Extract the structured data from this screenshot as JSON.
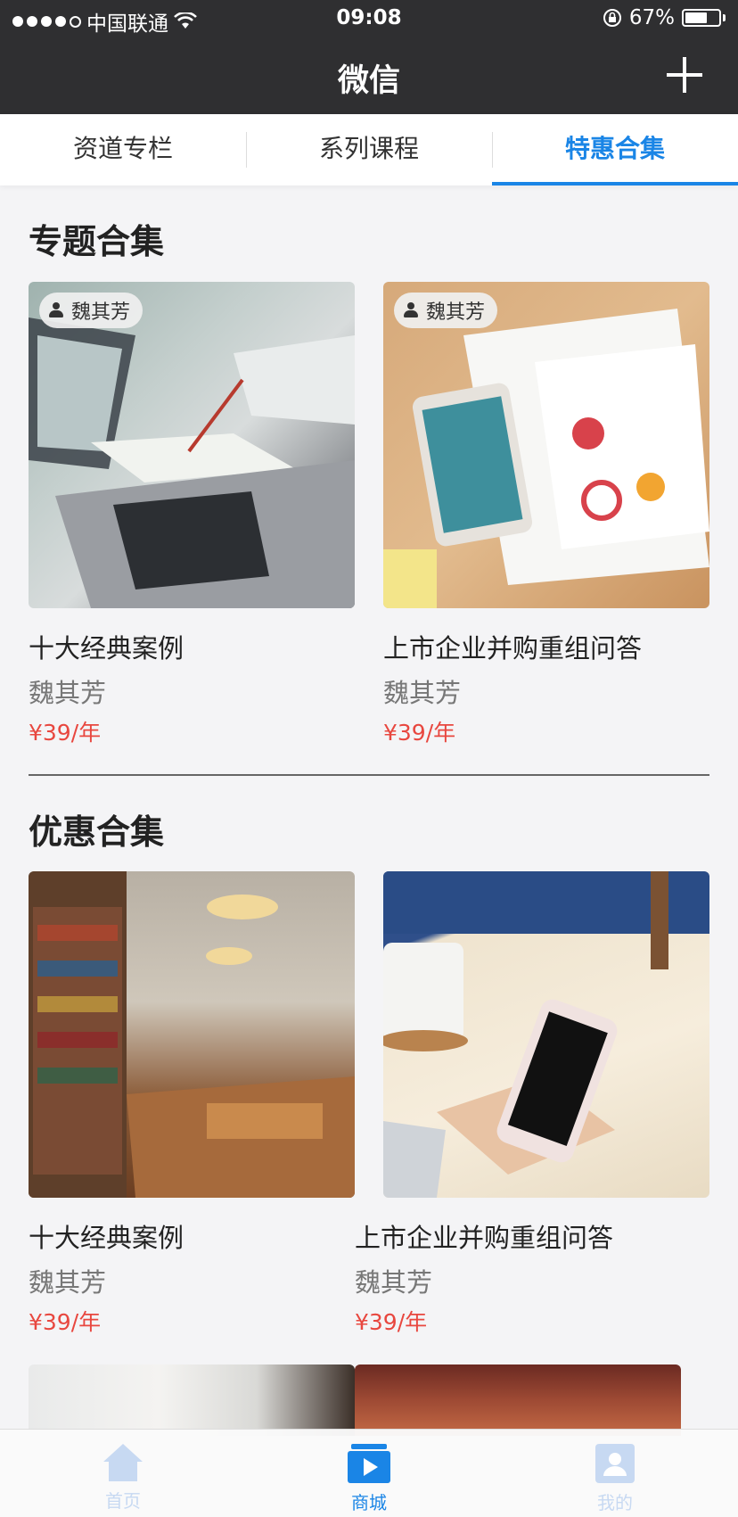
{
  "status": {
    "carrier": "中国联通",
    "time": "09:08",
    "battery_text": "67%",
    "battery_level": 0.67
  },
  "nav": {
    "title": "微信"
  },
  "tabs": [
    {
      "label": "资道专栏",
      "active": false
    },
    {
      "label": "系列课程",
      "active": false
    },
    {
      "label": "特惠合集",
      "active": true
    }
  ],
  "sections": {
    "topics": {
      "title": "专题合集",
      "cards": [
        {
          "tag": "魏其芳",
          "title": "十大经典案例",
          "author": "魏其芳",
          "price": "¥39/年"
        },
        {
          "tag": "魏其芳",
          "title": "上市企业并购重组问答",
          "author": "魏其芳",
          "price": "¥39/年"
        }
      ]
    },
    "deals": {
      "title": "优惠合集",
      "cards": [
        {
          "title": "十大经典案例",
          "author": "魏其芳",
          "price": "¥39/年"
        },
        {
          "title": "上市企业并购重组问答",
          "author": "魏其芳",
          "price": "¥39/年"
        }
      ]
    }
  },
  "tabbar": [
    {
      "label": "首页",
      "icon": "home-icon"
    },
    {
      "label": "商城",
      "icon": "store-icon"
    },
    {
      "label": "我的",
      "icon": "profile-icon"
    }
  ],
  "colors": {
    "accent": "#1a85e6",
    "price": "#e8473f",
    "header": "#2f2f31"
  }
}
